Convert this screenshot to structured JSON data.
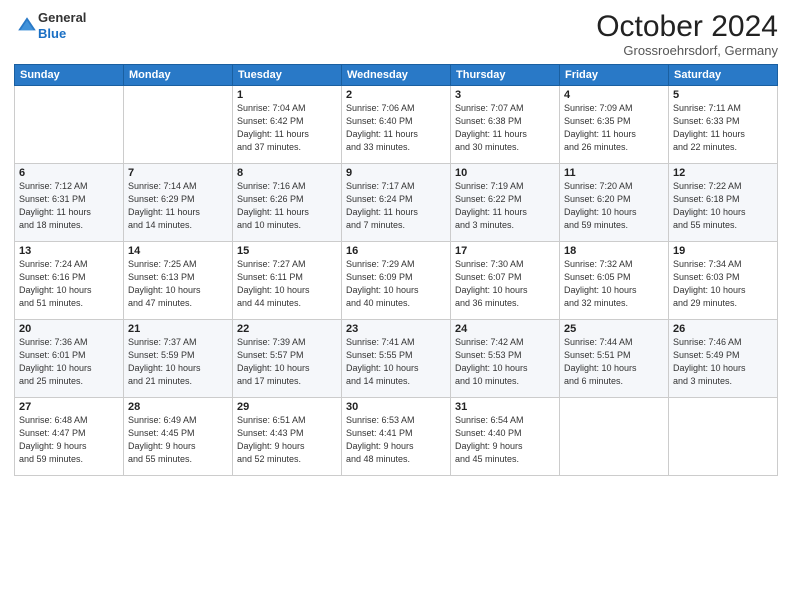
{
  "logo": {
    "line1": "General",
    "line2": "Blue"
  },
  "title": "October 2024",
  "location": "Grossroehrsdorf, Germany",
  "weekdays": [
    "Sunday",
    "Monday",
    "Tuesday",
    "Wednesday",
    "Thursday",
    "Friday",
    "Saturday"
  ],
  "weeks": [
    [
      {
        "day": "",
        "detail": ""
      },
      {
        "day": "",
        "detail": ""
      },
      {
        "day": "1",
        "detail": "Sunrise: 7:04 AM\nSunset: 6:42 PM\nDaylight: 11 hours\nand 37 minutes."
      },
      {
        "day": "2",
        "detail": "Sunrise: 7:06 AM\nSunset: 6:40 PM\nDaylight: 11 hours\nand 33 minutes."
      },
      {
        "day": "3",
        "detail": "Sunrise: 7:07 AM\nSunset: 6:38 PM\nDaylight: 11 hours\nand 30 minutes."
      },
      {
        "day": "4",
        "detail": "Sunrise: 7:09 AM\nSunset: 6:35 PM\nDaylight: 11 hours\nand 26 minutes."
      },
      {
        "day": "5",
        "detail": "Sunrise: 7:11 AM\nSunset: 6:33 PM\nDaylight: 11 hours\nand 22 minutes."
      }
    ],
    [
      {
        "day": "6",
        "detail": "Sunrise: 7:12 AM\nSunset: 6:31 PM\nDaylight: 11 hours\nand 18 minutes."
      },
      {
        "day": "7",
        "detail": "Sunrise: 7:14 AM\nSunset: 6:29 PM\nDaylight: 11 hours\nand 14 minutes."
      },
      {
        "day": "8",
        "detail": "Sunrise: 7:16 AM\nSunset: 6:26 PM\nDaylight: 11 hours\nand 10 minutes."
      },
      {
        "day": "9",
        "detail": "Sunrise: 7:17 AM\nSunset: 6:24 PM\nDaylight: 11 hours\nand 7 minutes."
      },
      {
        "day": "10",
        "detail": "Sunrise: 7:19 AM\nSunset: 6:22 PM\nDaylight: 11 hours\nand 3 minutes."
      },
      {
        "day": "11",
        "detail": "Sunrise: 7:20 AM\nSunset: 6:20 PM\nDaylight: 10 hours\nand 59 minutes."
      },
      {
        "day": "12",
        "detail": "Sunrise: 7:22 AM\nSunset: 6:18 PM\nDaylight: 10 hours\nand 55 minutes."
      }
    ],
    [
      {
        "day": "13",
        "detail": "Sunrise: 7:24 AM\nSunset: 6:16 PM\nDaylight: 10 hours\nand 51 minutes."
      },
      {
        "day": "14",
        "detail": "Sunrise: 7:25 AM\nSunset: 6:13 PM\nDaylight: 10 hours\nand 47 minutes."
      },
      {
        "day": "15",
        "detail": "Sunrise: 7:27 AM\nSunset: 6:11 PM\nDaylight: 10 hours\nand 44 minutes."
      },
      {
        "day": "16",
        "detail": "Sunrise: 7:29 AM\nSunset: 6:09 PM\nDaylight: 10 hours\nand 40 minutes."
      },
      {
        "day": "17",
        "detail": "Sunrise: 7:30 AM\nSunset: 6:07 PM\nDaylight: 10 hours\nand 36 minutes."
      },
      {
        "day": "18",
        "detail": "Sunrise: 7:32 AM\nSunset: 6:05 PM\nDaylight: 10 hours\nand 32 minutes."
      },
      {
        "day": "19",
        "detail": "Sunrise: 7:34 AM\nSunset: 6:03 PM\nDaylight: 10 hours\nand 29 minutes."
      }
    ],
    [
      {
        "day": "20",
        "detail": "Sunrise: 7:36 AM\nSunset: 6:01 PM\nDaylight: 10 hours\nand 25 minutes."
      },
      {
        "day": "21",
        "detail": "Sunrise: 7:37 AM\nSunset: 5:59 PM\nDaylight: 10 hours\nand 21 minutes."
      },
      {
        "day": "22",
        "detail": "Sunrise: 7:39 AM\nSunset: 5:57 PM\nDaylight: 10 hours\nand 17 minutes."
      },
      {
        "day": "23",
        "detail": "Sunrise: 7:41 AM\nSunset: 5:55 PM\nDaylight: 10 hours\nand 14 minutes."
      },
      {
        "day": "24",
        "detail": "Sunrise: 7:42 AM\nSunset: 5:53 PM\nDaylight: 10 hours\nand 10 minutes."
      },
      {
        "day": "25",
        "detail": "Sunrise: 7:44 AM\nSunset: 5:51 PM\nDaylight: 10 hours\nand 6 minutes."
      },
      {
        "day": "26",
        "detail": "Sunrise: 7:46 AM\nSunset: 5:49 PM\nDaylight: 10 hours\nand 3 minutes."
      }
    ],
    [
      {
        "day": "27",
        "detail": "Sunrise: 6:48 AM\nSunset: 4:47 PM\nDaylight: 9 hours\nand 59 minutes."
      },
      {
        "day": "28",
        "detail": "Sunrise: 6:49 AM\nSunset: 4:45 PM\nDaylight: 9 hours\nand 55 minutes."
      },
      {
        "day": "29",
        "detail": "Sunrise: 6:51 AM\nSunset: 4:43 PM\nDaylight: 9 hours\nand 52 minutes."
      },
      {
        "day": "30",
        "detail": "Sunrise: 6:53 AM\nSunset: 4:41 PM\nDaylight: 9 hours\nand 48 minutes."
      },
      {
        "day": "31",
        "detail": "Sunrise: 6:54 AM\nSunset: 4:40 PM\nDaylight: 9 hours\nand 45 minutes."
      },
      {
        "day": "",
        "detail": ""
      },
      {
        "day": "",
        "detail": ""
      }
    ]
  ]
}
